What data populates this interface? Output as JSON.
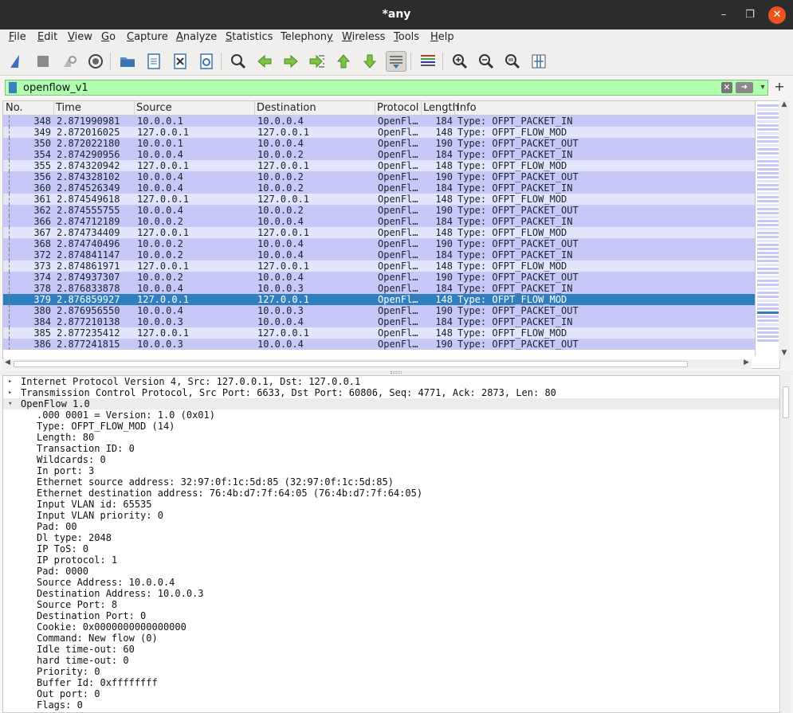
{
  "window": {
    "title": "*any",
    "min": "–",
    "max": "❐",
    "close": "✕"
  },
  "menu": [
    {
      "label": "File",
      "u": "F"
    },
    {
      "label": "Edit",
      "u": "E"
    },
    {
      "label": "View",
      "u": "V"
    },
    {
      "label": "Go",
      "u": "G"
    },
    {
      "label": "Capture",
      "u": "C"
    },
    {
      "label": "Analyze",
      "u": "A"
    },
    {
      "label": "Statistics",
      "u": "S"
    },
    {
      "label": "Telephony",
      "u": "y"
    },
    {
      "label": "Wireless",
      "u": "W"
    },
    {
      "label": "Tools",
      "u": "T"
    },
    {
      "label": "Help",
      "u": "H"
    }
  ],
  "toolbar_icons": [
    "shark-fin-start-icon",
    "stop-capture-icon",
    "restart-capture-icon",
    "capture-options-icon",
    "open-file-icon",
    "save-file-icon",
    "close-file-icon",
    "reload-file-icon",
    "find-packet-icon",
    "go-back-icon",
    "go-forward-icon",
    "go-to-packet-icon",
    "first-packet-icon",
    "last-packet-icon",
    "autoscroll-icon",
    "colorize-icon",
    "zoom-in-icon",
    "zoom-out-icon",
    "normal-size-icon",
    "resize-columns-icon"
  ],
  "filter": {
    "value": "openflow_v1",
    "clear": "✕",
    "apply": "➜",
    "dropdown": "▾",
    "add": "+"
  },
  "columns": [
    "No.",
    "Time",
    "Source",
    "Destination",
    "Protocol",
    "Length",
    "Info"
  ],
  "packets": [
    {
      "no": "348",
      "time": "2.871990981",
      "src": "10.0.0.1",
      "dst": "10.0.0.4",
      "proto": "OpenFl…",
      "len": "184",
      "info": "Type: OFPT_PACKET_IN",
      "c": "c0"
    },
    {
      "no": "349",
      "time": "2.872016025",
      "src": "127.0.0.1",
      "dst": "127.0.0.1",
      "proto": "OpenFl…",
      "len": "148",
      "info": "Type: OFPT_FLOW_MOD",
      "c": "c1"
    },
    {
      "no": "350",
      "time": "2.872022180",
      "src": "10.0.0.1",
      "dst": "10.0.0.4",
      "proto": "OpenFl…",
      "len": "190",
      "info": "Type: OFPT_PACKET_OUT",
      "c": "c0"
    },
    {
      "no": "354",
      "time": "2.874290956",
      "src": "10.0.0.4",
      "dst": "10.0.0.2",
      "proto": "OpenFl…",
      "len": "184",
      "info": "Type: OFPT_PACKET_IN",
      "c": "c0"
    },
    {
      "no": "355",
      "time": "2.874320942",
      "src": "127.0.0.1",
      "dst": "127.0.0.1",
      "proto": "OpenFl…",
      "len": "148",
      "info": "Type: OFPT_FLOW_MOD",
      "c": "c1"
    },
    {
      "no": "356",
      "time": "2.874328102",
      "src": "10.0.0.4",
      "dst": "10.0.0.2",
      "proto": "OpenFl…",
      "len": "190",
      "info": "Type: OFPT_PACKET_OUT",
      "c": "c0"
    },
    {
      "no": "360",
      "time": "2.874526349",
      "src": "10.0.0.4",
      "dst": "10.0.0.2",
      "proto": "OpenFl…",
      "len": "184",
      "info": "Type: OFPT_PACKET_IN",
      "c": "c0"
    },
    {
      "no": "361",
      "time": "2.874549618",
      "src": "127.0.0.1",
      "dst": "127.0.0.1",
      "proto": "OpenFl…",
      "len": "148",
      "info": "Type: OFPT_FLOW_MOD",
      "c": "c1"
    },
    {
      "no": "362",
      "time": "2.874555755",
      "src": "10.0.0.4",
      "dst": "10.0.0.2",
      "proto": "OpenFl…",
      "len": "190",
      "info": "Type: OFPT_PACKET_OUT",
      "c": "c0"
    },
    {
      "no": "366",
      "time": "2.874712189",
      "src": "10.0.0.2",
      "dst": "10.0.0.4",
      "proto": "OpenFl…",
      "len": "184",
      "info": "Type: OFPT_PACKET_IN",
      "c": "c0"
    },
    {
      "no": "367",
      "time": "2.874734409",
      "src": "127.0.0.1",
      "dst": "127.0.0.1",
      "proto": "OpenFl…",
      "len": "148",
      "info": "Type: OFPT_FLOW_MOD",
      "c": "c1"
    },
    {
      "no": "368",
      "time": "2.874740496",
      "src": "10.0.0.2",
      "dst": "10.0.0.4",
      "proto": "OpenFl…",
      "len": "190",
      "info": "Type: OFPT_PACKET_OUT",
      "c": "c0"
    },
    {
      "no": "372",
      "time": "2.874841147",
      "src": "10.0.0.2",
      "dst": "10.0.0.4",
      "proto": "OpenFl…",
      "len": "184",
      "info": "Type: OFPT_PACKET_IN",
      "c": "c0"
    },
    {
      "no": "373",
      "time": "2.874861971",
      "src": "127.0.0.1",
      "dst": "127.0.0.1",
      "proto": "OpenFl…",
      "len": "148",
      "info": "Type: OFPT_FLOW_MOD",
      "c": "c1"
    },
    {
      "no": "374",
      "time": "2.874937307",
      "src": "10.0.0.2",
      "dst": "10.0.0.4",
      "proto": "OpenFl…",
      "len": "190",
      "info": "Type: OFPT_PACKET_OUT",
      "c": "c0"
    },
    {
      "no": "378",
      "time": "2.876833878",
      "src": "10.0.0.4",
      "dst": "10.0.0.3",
      "proto": "OpenFl…",
      "len": "184",
      "info": "Type: OFPT_PACKET_IN",
      "c": "c0"
    },
    {
      "no": "379",
      "time": "2.876859927",
      "src": "127.0.0.1",
      "dst": "127.0.0.1",
      "proto": "OpenFl…",
      "len": "148",
      "info": "Type: OFPT_FLOW_MOD",
      "c": "sel"
    },
    {
      "no": "380",
      "time": "2.876956550",
      "src": "10.0.0.4",
      "dst": "10.0.0.3",
      "proto": "OpenFl…",
      "len": "190",
      "info": "Type: OFPT_PACKET_OUT",
      "c": "c0"
    },
    {
      "no": "384",
      "time": "2.877210138",
      "src": "10.0.0.3",
      "dst": "10.0.0.4",
      "proto": "OpenFl…",
      "len": "184",
      "info": "Type: OFPT_PACKET_IN",
      "c": "c0"
    },
    {
      "no": "385",
      "time": "2.877235412",
      "src": "127.0.0.1",
      "dst": "127.0.0.1",
      "proto": "OpenFl…",
      "len": "148",
      "info": "Type: OFPT_FLOW_MOD",
      "c": "c1"
    },
    {
      "no": "386",
      "time": "2.877241815",
      "src": "10.0.0.3",
      "dst": "10.0.0.4",
      "proto": "OpenFl…",
      "len": "190",
      "info": "Type: OFPT_PACKET_OUT",
      "c": "c0"
    }
  ],
  "details": [
    {
      "text": "Internet Protocol Version 4, Src: 127.0.0.1, Dst: 127.0.0.1",
      "tri": "▸",
      "level": 0
    },
    {
      "text": "Transmission Control Protocol, Src Port: 6633, Dst Port: 60806, Seq: 4771, Ack: 2873, Len: 80",
      "tri": "▸",
      "level": 0
    },
    {
      "text": "OpenFlow 1.0",
      "tri": "▾",
      "level": 0,
      "expanded": true
    },
    {
      "text": ".000 0001 = Version: 1.0 (0x01)",
      "level": 1
    },
    {
      "text": "Type: OFPT_FLOW_MOD (14)",
      "level": 1
    },
    {
      "text": "Length: 80",
      "level": 1
    },
    {
      "text": "Transaction ID: 0",
      "level": 1
    },
    {
      "text": "Wildcards: 0",
      "level": 1
    },
    {
      "text": "In port: 3",
      "level": 1
    },
    {
      "text": "Ethernet source address: 32:97:0f:1c:5d:85 (32:97:0f:1c:5d:85)",
      "level": 1
    },
    {
      "text": "Ethernet destination address: 76:4b:d7:7f:64:05 (76:4b:d7:7f:64:05)",
      "level": 1
    },
    {
      "text": "Input VLAN id: 65535",
      "level": 1
    },
    {
      "text": "Input VLAN priority: 0",
      "level": 1
    },
    {
      "text": "Pad: 00",
      "level": 1
    },
    {
      "text": "Dl type: 2048",
      "level": 1
    },
    {
      "text": "IP ToS: 0",
      "level": 1
    },
    {
      "text": "IP protocol: 1",
      "level": 1
    },
    {
      "text": "Pad: 0000",
      "level": 1
    },
    {
      "text": "Source Address: 10.0.0.4",
      "level": 1
    },
    {
      "text": "Destination Address: 10.0.0.3",
      "level": 1
    },
    {
      "text": "Source Port: 8",
      "level": 1
    },
    {
      "text": "Destination Port: 0",
      "level": 1
    },
    {
      "text": "Cookie: 0x0000000000000000",
      "level": 1
    },
    {
      "text": "Command: New flow (0)",
      "level": 1
    },
    {
      "text": "Idle time-out: 60",
      "level": 1
    },
    {
      "text": "hard time-out: 0",
      "level": 1
    },
    {
      "text": "Priority: 0",
      "level": 1
    },
    {
      "text": "Buffer Id: 0xffffffff",
      "level": 1
    },
    {
      "text": "Out port: 0",
      "level": 1
    },
    {
      "text": "Flags: 0",
      "level": 1
    }
  ],
  "colors": {
    "row_packet": "#c8c8f8",
    "row_flowmod": "#e4e4fb",
    "row_selected": "#2f7fbf",
    "filter_valid": "#afffaf",
    "close_button": "#e95420"
  }
}
